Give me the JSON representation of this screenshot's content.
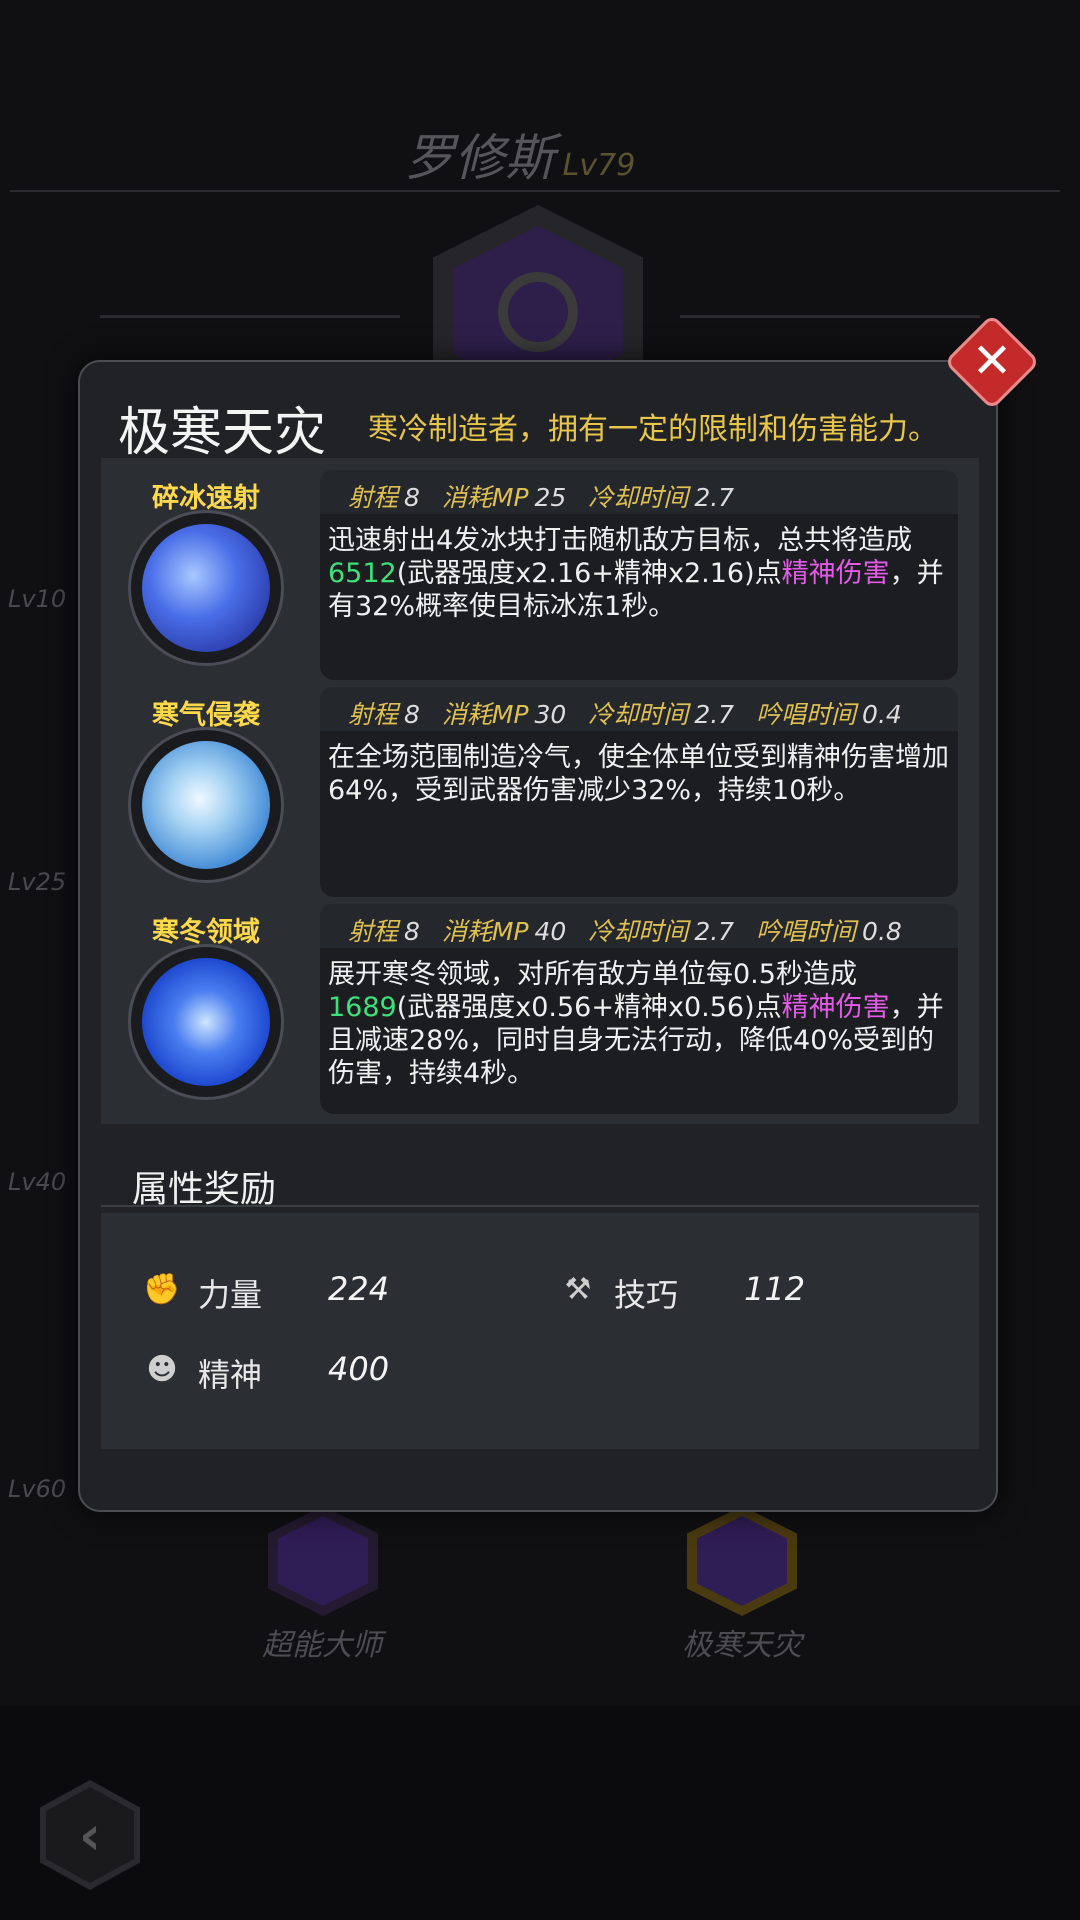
{
  "character": {
    "name": "罗修斯",
    "level": "Lv79"
  },
  "tree_levels": [
    "Lv10",
    "Lv25",
    "Lv40",
    "Lv60"
  ],
  "tree_nodes": [
    {
      "label": "超能大师",
      "selected": false
    },
    {
      "label": "极寒天灾",
      "selected": true
    }
  ],
  "modal": {
    "title": "极寒天灾",
    "description": "寒冷制造者，拥有一定的限制和伤害能力。",
    "close_icon": "✕"
  },
  "stat_labels": {
    "range": "射程",
    "mp": "消耗MP",
    "cooldown": "冷却时间",
    "cast": "吟唱时间"
  },
  "skills": [
    {
      "name": "碎冰速射",
      "range": "8",
      "mp": "25",
      "cooldown": "2.7",
      "cast": "",
      "desc": [
        {
          "t": "迅速射出4发冰块打击随机敌方目标，总共将造成"
        },
        {
          "t": "6512",
          "c": "green"
        },
        {
          "t": "(武器强度x2.16+精神x2.16)点"
        },
        {
          "t": "精神伤害",
          "c": "pink"
        },
        {
          "t": "，并有32%概率使目标冰冻1秒。"
        }
      ]
    },
    {
      "name": "寒气侵袭",
      "range": "8",
      "mp": "30",
      "cooldown": "2.7",
      "cast": "0.4",
      "desc": [
        {
          "t": "在全场范围制造冷气，使全体单位受到精神伤害增加64%，受到武器伤害减少32%，持续10秒。"
        }
      ]
    },
    {
      "name": "寒冬领域",
      "range": "8",
      "mp": "40",
      "cooldown": "2.7",
      "cast": "0.8",
      "desc": [
        {
          "t": "展开寒冬领域，对所有敌方单位每0.5秒造成"
        },
        {
          "t": "1689",
          "c": "green"
        },
        {
          "t": "(武器强度x0.56+精神x0.56)点"
        },
        {
          "t": "精神伤害",
          "c": "pink"
        },
        {
          "t": "，并且减速28%，同时自身无法行动，降低40%受到的伤害，持续4秒。"
        }
      ]
    }
  ],
  "attributes": {
    "title": "属性奖励",
    "items": [
      {
        "icon": "fist-icon",
        "label": "力量",
        "value": "224"
      },
      {
        "icon": "tools-icon",
        "label": "技巧",
        "value": "112"
      },
      {
        "icon": "head-icon",
        "label": "精神",
        "value": "400"
      }
    ]
  },
  "nav": {
    "back_icon": "‹"
  },
  "colors": {
    "highlight_green": "#3de07a",
    "highlight_pink": "#e45ae8",
    "skill_name": "#ffd94a",
    "stat_label": "#e0c050"
  }
}
